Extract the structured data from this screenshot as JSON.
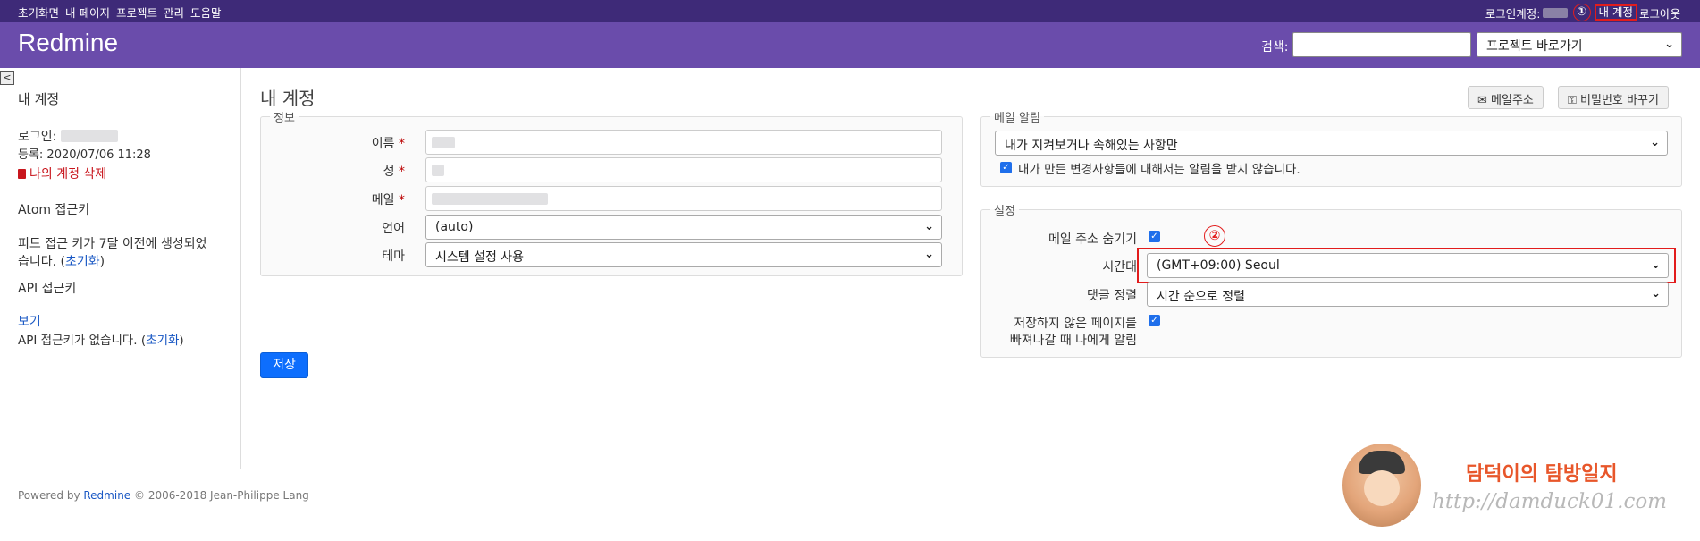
{
  "top_menu": {
    "items": [
      "초기화면",
      "내 페이지",
      "프로젝트",
      "관리",
      "도움말"
    ],
    "logged_in_label": "로그인계정:",
    "annotation_1": "①",
    "my_account": "내 계정",
    "logout": "로그아웃"
  },
  "header": {
    "title": "Redmine",
    "search_label": "검색:",
    "jump_select": "프로젝트 바로가기"
  },
  "sidebar": {
    "title": "내 계정",
    "login_label": "로그인:",
    "registered": "등록: 2020/07/06 11:28",
    "delete_account": "나의 계정 삭제",
    "atom_heading": "Atom 접근키",
    "feed_note": "피드 접근 키가 7달 이전에 생성되었",
    "feed_note2": "습니다. (",
    "reset": "초기화",
    "close_paren": ")",
    "api_heading": "API 접근키",
    "show": "보기",
    "api_note": "API 접근키가 없습니다. ("
  },
  "main": {
    "title": "내 계정",
    "email_button": "메일주소",
    "password_button": "비밀번호 바꾸기",
    "info": {
      "legend": "정보",
      "first_name": "이름",
      "last_name": "성",
      "email": "메일",
      "required_mark": "*",
      "language_label": "언어",
      "language_value": "(auto)",
      "theme_label": "테마",
      "theme_value": "시스템 설정 사용"
    },
    "save": "저장",
    "mail_notification": {
      "legend": "메일 알림",
      "select_value": "내가 지켜보거나 속해있는 사항만",
      "no_self_notified": "내가 만든 변경사항들에 대해서는 알림을 받지 않습니다."
    },
    "preferences": {
      "legend": "설정",
      "hide_mail": "메일 주소 숨기기",
      "annotation_2": "②",
      "timezone_label": "시간대",
      "timezone_value": "(GMT+09:00) Seoul",
      "comments_sorting_label": "댓글 정렬",
      "comments_sorting_value": "시간 순으로 정렬",
      "warn_unsaved_1": "저장하지 않은 페이지를",
      "warn_unsaved_2": "빠져나갈 때 나에게 알림"
    }
  },
  "footer": {
    "powered_by": "Powered by ",
    "redmine_link": "Redmine",
    "copyright": " © 2006-2018 Jean-Philippe Lang"
  },
  "watermark": {
    "name": "담덕이의 탐방일지",
    "url": "http://damduck01.com"
  },
  "colors": {
    "top_menu_bg": "#3e2a78",
    "header_bg": "#6a4cab",
    "accent": "#0d6efd",
    "annotation_red": "#e21c1c"
  }
}
